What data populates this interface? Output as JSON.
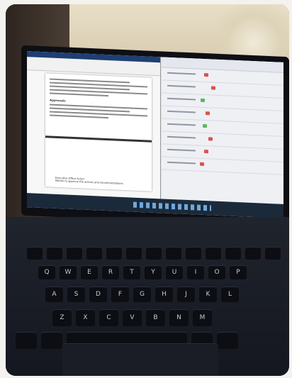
{
  "photo": {
    "subject": "laptop-with-document-open"
  },
  "doc": {
    "heading_1": "Approvals",
    "footer_label": "Executive Office Action",
    "footer_text": "Motion to approve the actions and recommendations"
  },
  "keyboard": {
    "row_1": [
      "Q",
      "W",
      "E",
      "R",
      "T",
      "Y",
      "U",
      "I",
      "O",
      "P"
    ],
    "row_2": [
      "A",
      "S",
      "D",
      "F",
      "G",
      "H",
      "J",
      "K",
      "L"
    ],
    "row_3": [
      "Z",
      "X",
      "C",
      "V",
      "B",
      "N",
      "M"
    ]
  },
  "colors": {
    "word_ribbon": "#2b579a",
    "taskbar": "#1b2a3a",
    "deck": "#141720"
  }
}
